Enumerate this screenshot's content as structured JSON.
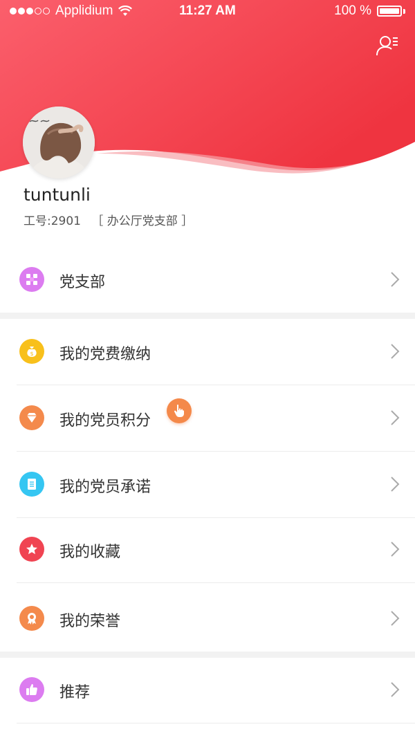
{
  "status_bar": {
    "carrier": "Applidium",
    "time": "11:27 AM",
    "battery": "100 %"
  },
  "header": {
    "gradient_start": "#fb5f6c",
    "gradient_end": "#ef3440",
    "profile_icon": "user-list-icon"
  },
  "profile": {
    "username": "tuntunli",
    "employee_id": "工号:2901",
    "department": "［ 办公厅党支部 ］"
  },
  "sections": [
    {
      "items": [
        {
          "label": "党支部",
          "icon": "grid-icon",
          "color": "#dc7cf0"
        }
      ]
    },
    {
      "items": [
        {
          "label": "我的党费缴纳",
          "icon": "money-bag-icon",
          "color": "#f8c01b"
        },
        {
          "label": "我的党员积分",
          "icon": "diamond-icon",
          "color": "#f48a4c"
        },
        {
          "label": "我的党员承诺",
          "icon": "document-icon",
          "color": "#35c6f2"
        },
        {
          "label": "我的收藏",
          "icon": "star-icon",
          "color": "#f04452"
        },
        {
          "label": "我的荣誉",
          "icon": "medal-icon",
          "color": "#f48a4c"
        }
      ]
    },
    {
      "items": [
        {
          "label": "推荐",
          "icon": "thumbs-up-icon",
          "color": "#dc7cf0"
        }
      ]
    }
  ]
}
